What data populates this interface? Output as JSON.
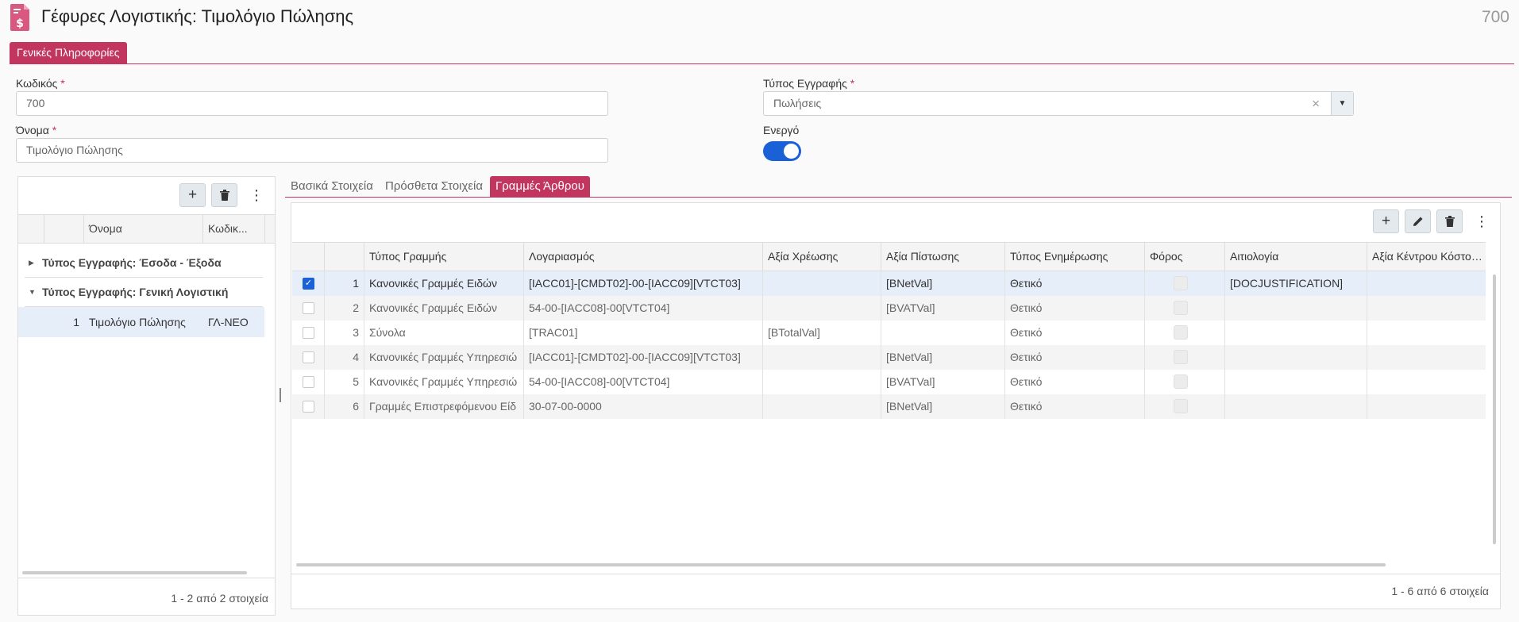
{
  "header": {
    "title": "Γέφυρες Λογιστικής: Τιμολόγιο Πώλησης",
    "record_id": "700"
  },
  "main_tab": {
    "label": "Γενικές Πληροφορίες"
  },
  "form": {
    "code": {
      "label": "Κωδικός",
      "required": "*",
      "value": "700"
    },
    "name": {
      "label": "Όνομα",
      "required": "*",
      "value": "Τιμολόγιο Πώλησης"
    },
    "entry_type": {
      "label": "Τύπος Εγγραφής",
      "required": "*",
      "value": "Πωλήσεις",
      "clear": "×"
    },
    "active": {
      "label": "Ενεργό",
      "on": true
    }
  },
  "left_panel": {
    "columns": {
      "name": "Όνομα",
      "code": "Κωδικ..."
    },
    "groups": [
      {
        "label": "Τύπος Εγγραφής: Έσοδα - Έξοδα",
        "expanded": false
      },
      {
        "label": "Τύπος Εγγραφής: Γενική Λογιστική",
        "expanded": true
      }
    ],
    "row": {
      "num": "1",
      "name": "Τιμολόγιο Πώλησης",
      "code": "ΓΛ-ΝΕΟ"
    },
    "pager": "1 - 2 από 2 στοιχεία"
  },
  "detail_tabs": {
    "basic": "Βασικά Στοιχεία",
    "extra": "Πρόσθετα Στοιχεία",
    "lines": "Γραμμές Άρθρου"
  },
  "lines_grid": {
    "columns": {
      "line_type": "Τύπος Γραμμής",
      "account": "Λογαριασμός",
      "debit": "Αξία Χρέωσης",
      "credit": "Αξία Πίστωσης",
      "update_type": "Τύπος Ενημέρωσης",
      "tax": "Φόρος",
      "justification": "Αιτιολογία",
      "cost_center": "Αξία Κέντρου Κόστου..."
    },
    "rows": [
      {
        "num": "1",
        "line_type": "Κανονικές Γραμμές Ειδών",
        "account": "[IACC01]-[CMDT02]-00-[IACC09][VTCT03]",
        "debit": "",
        "credit": "[BNetVal]",
        "update_type": "Θετικό",
        "justification": "[DOCJUSTIFICATION]",
        "selected": true
      },
      {
        "num": "2",
        "line_type": "Κανονικές Γραμμές Ειδών",
        "account": "54-00-[IACC08]-00[VTCT04]",
        "debit": "",
        "credit": "[BVATVal]",
        "update_type": "Θετικό",
        "justification": "",
        "selected": false
      },
      {
        "num": "3",
        "line_type": "Σύνολα",
        "account": "[TRAC01]",
        "debit": "[BTotalVal]",
        "credit": "",
        "update_type": "Θετικό",
        "justification": "",
        "selected": false
      },
      {
        "num": "4",
        "line_type": "Κανονικές Γραμμές Υπηρεσιώ",
        "account": "[IACC01]-[CMDT02]-00-[IACC09][VTCT03]",
        "debit": "",
        "credit": "[BNetVal]",
        "update_type": "Θετικό",
        "justification": "",
        "selected": false
      },
      {
        "num": "5",
        "line_type": "Κανονικές Γραμμές Υπηρεσιώ",
        "account": "54-00-[IACC08]-00[VTCT04]",
        "debit": "",
        "credit": "[BVATVal]",
        "update_type": "Θετικό",
        "justification": "",
        "selected": false
      },
      {
        "num": "6",
        "line_type": "Γραμμές Επιστρεφόμενου Είδ",
        "account": "30-07-00-0000",
        "debit": "",
        "credit": "[BNetVal]",
        "update_type": "Θετικό",
        "justification": "",
        "selected": false
      }
    ],
    "pager": "1 - 6 από 6 στοιχεία"
  },
  "colors": {
    "accent": "#c2355f",
    "toggle_on": "#1a60d6",
    "selection": "#e6eefa"
  }
}
